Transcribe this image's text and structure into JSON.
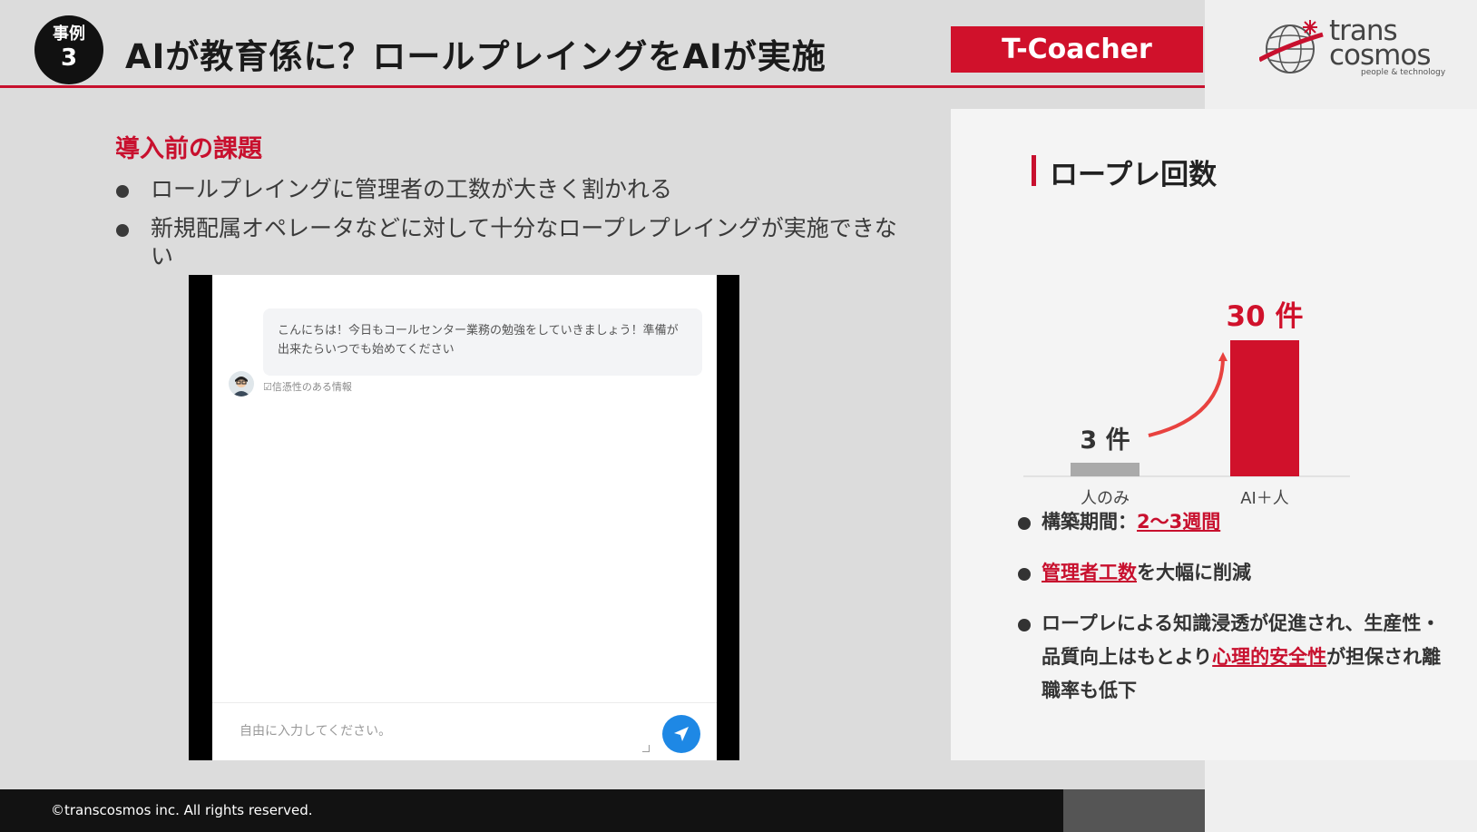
{
  "header": {
    "case_label": "事例",
    "case_number": "3",
    "title": "AIが教育係に？ロールプレイングをAIが実施",
    "product": "T-Coacher",
    "logo_line1": "trans",
    "logo_line2": "cosmos",
    "logo_tagline": "people & technology"
  },
  "challenges": {
    "title": "導入前の課題",
    "items": [
      "ロールプレイングに管理者の工数が大きく割かれる",
      "新規配属オペレータなどに対して十分なロープレプレイングが実施できない"
    ]
  },
  "chat": {
    "bot_message": "こんにちは！今日もコールセンター業務の勉強をしていきましょう！準備が出来たらいつでも始めてください",
    "reliability_note": "☑信憑性のある情報",
    "input_placeholder": "自由に入力してください。"
  },
  "results": {
    "chart_title": "ロープレ回数",
    "bullets": [
      {
        "pre": "構築期間：",
        "em": "2〜3週間",
        "post": ""
      },
      {
        "pre": "",
        "em": "管理者工数",
        "post": "を大幅に削減"
      }
    ],
    "bullet3": {
      "pre": "ロープレによる知識浸透が促進され、生産性・品質向上はもとより",
      "em": "心理的安全性",
      "post": "が担保され離職率も低下"
    }
  },
  "chart_data": {
    "type": "bar",
    "categories": [
      "人のみ",
      "AI＋人"
    ],
    "values": [
      3,
      30
    ],
    "value_labels": [
      "3 件",
      "30 件"
    ],
    "colors": [
      "#aaaaaa",
      "#d0112b"
    ],
    "title": "ロープレ回数",
    "ylim": [
      0,
      30
    ],
    "grid": false,
    "annotation": "arrow from 人のみ to AI＋人"
  },
  "footer": {
    "copyright": "©transcosmos inc. All rights reserved."
  }
}
